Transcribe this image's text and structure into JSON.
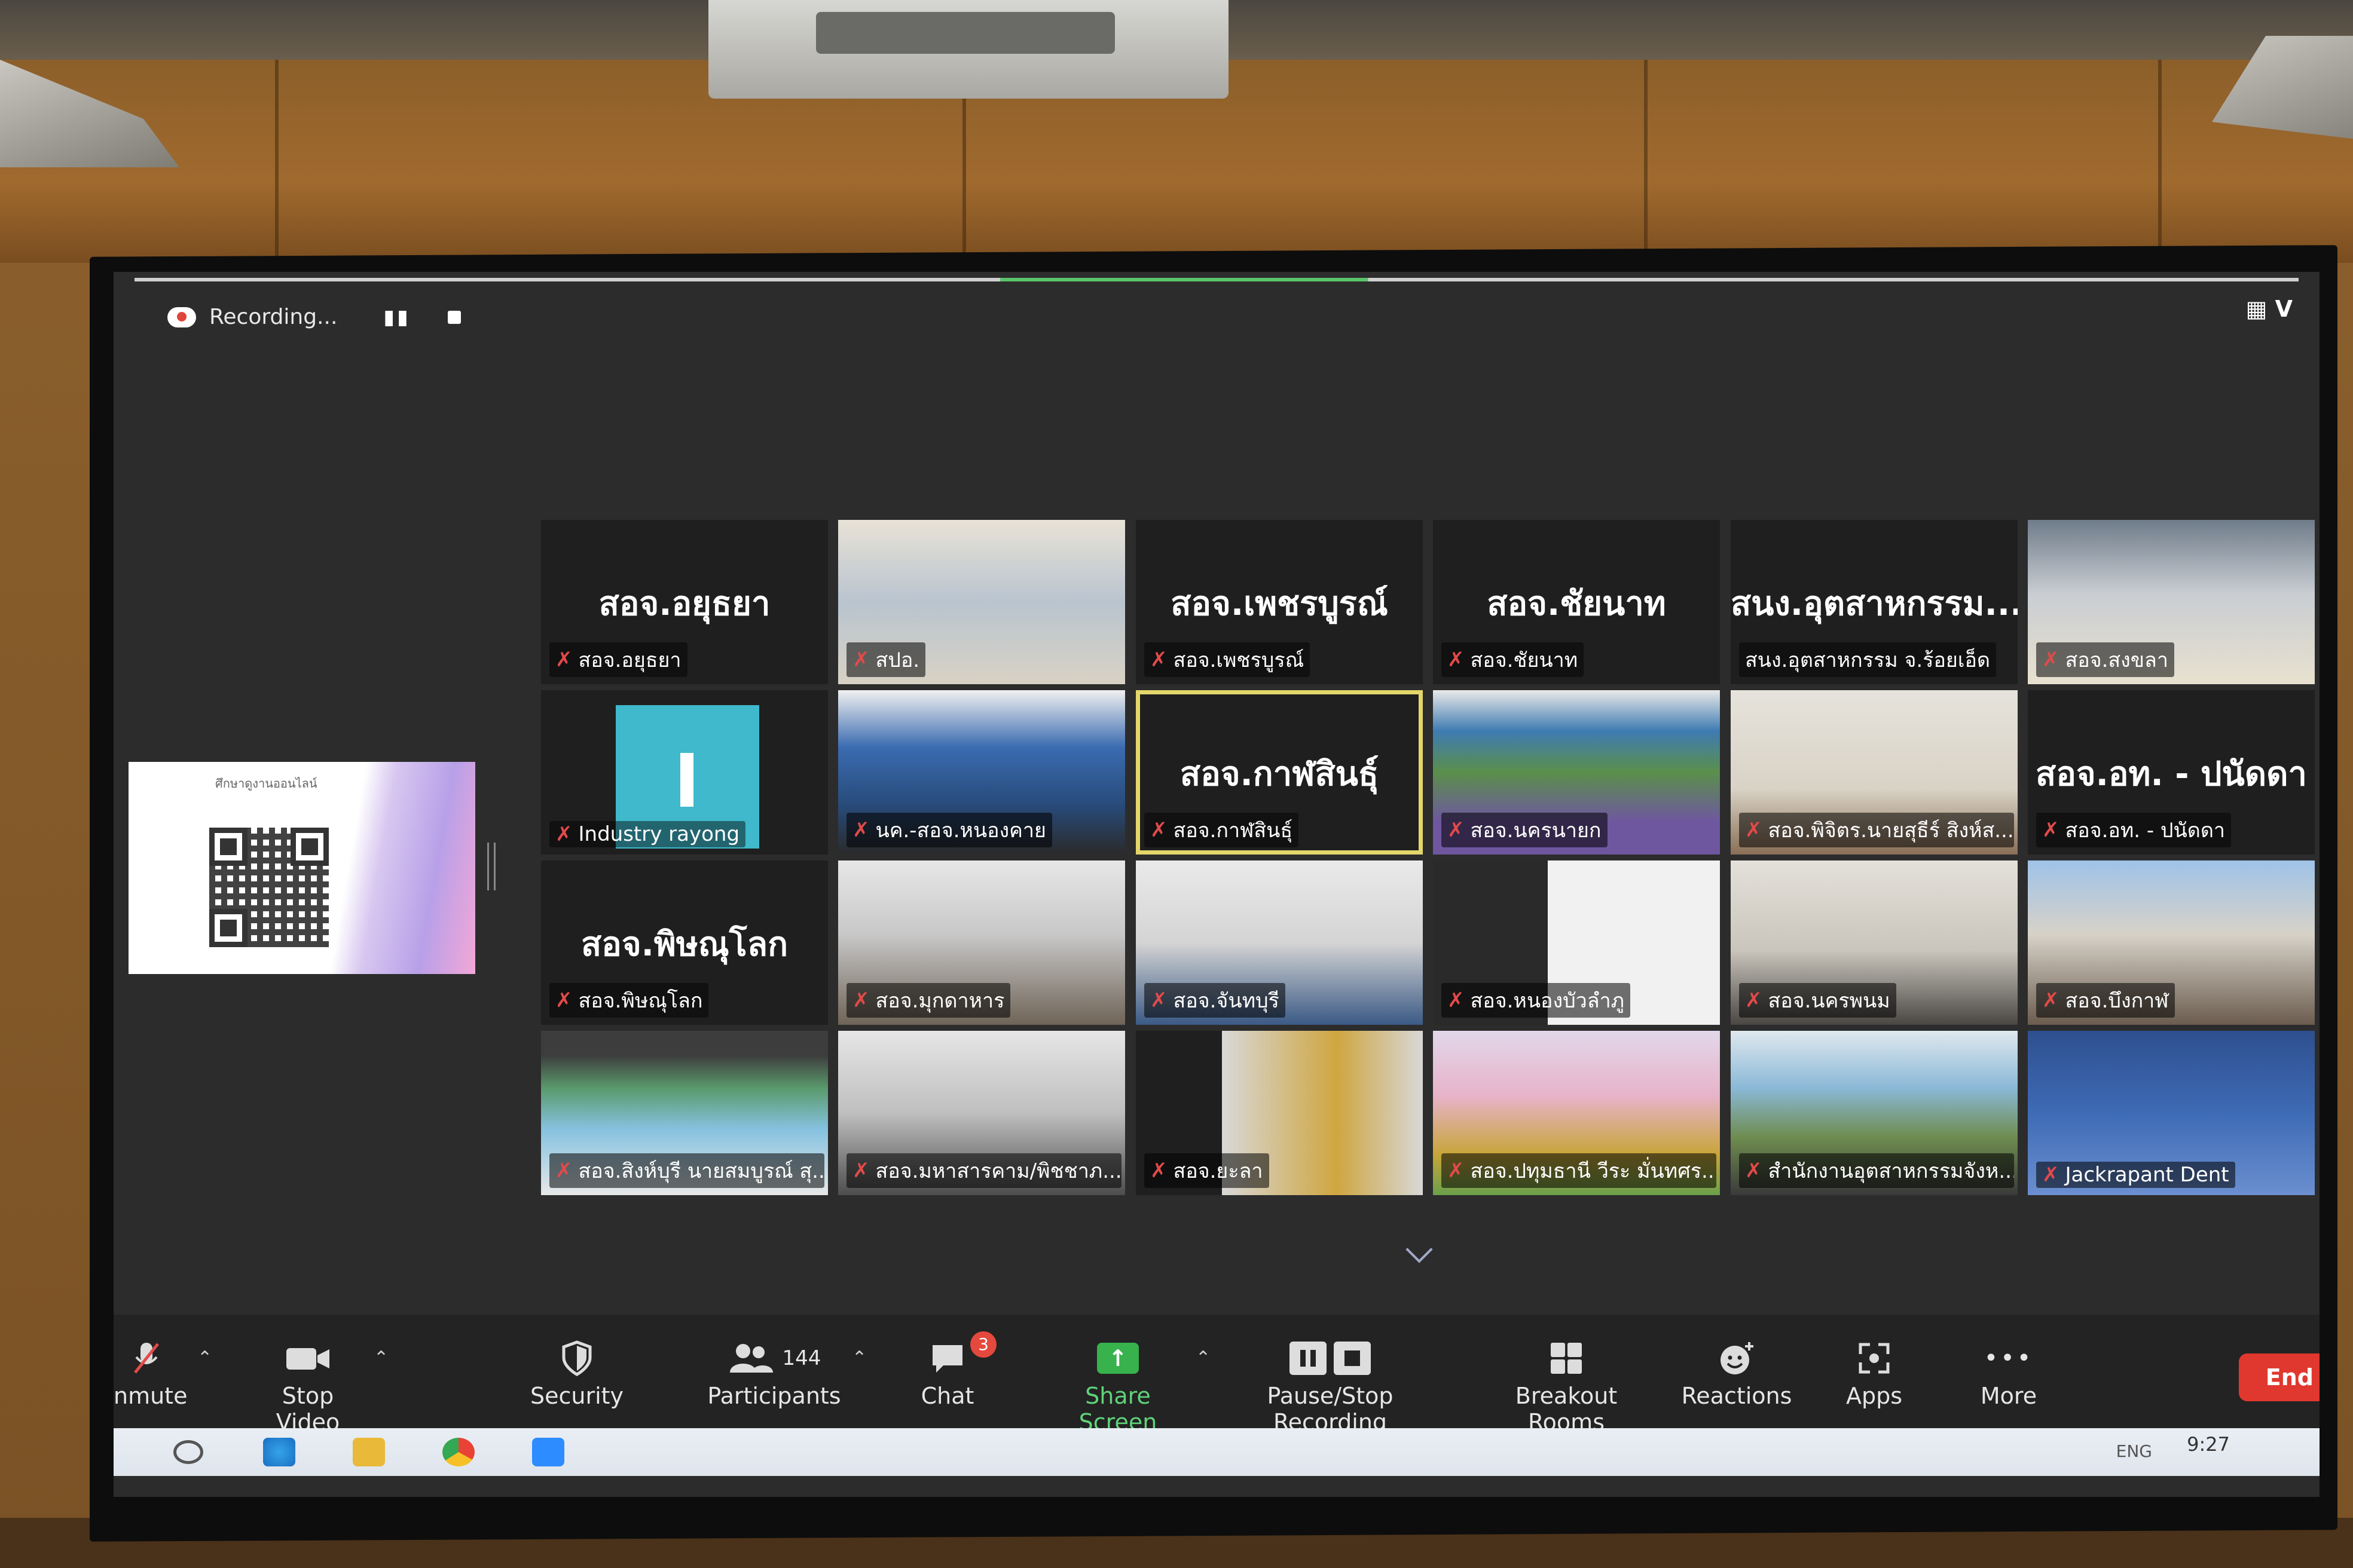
{
  "recording": {
    "label": "Recording...",
    "pause": "▮▮"
  },
  "view": {
    "label": "▦ V"
  },
  "share": {
    "caption": "ศึกษาดูงานออนไลน์"
  },
  "tiles": [
    {
      "big": "สอจ.อยุธยา",
      "name": "สอจ.อยุธยา",
      "muted": true
    },
    {
      "big": "",
      "name": "สปอ.",
      "muted": true
    },
    {
      "big": "สอจ.เพชรบูรณ์",
      "name": "สอจ.เพชรบูรณ์",
      "muted": true
    },
    {
      "big": "สอจ.ชัยนาท",
      "name": "สอจ.ชัยนาท",
      "muted": true
    },
    {
      "big": "สนง.อุตสาหกรรม...",
      "name": "สนง.อุตสาหกรรม จ.ร้อยเอ็ด",
      "muted": false
    },
    {
      "big": "",
      "name": "สอจ.สงขลา",
      "muted": true
    },
    {
      "big": "",
      "name": "Industry rayong",
      "muted": true
    },
    {
      "big": "",
      "name": "นค.-สอจ.หนองคาย",
      "muted": true
    },
    {
      "big": "สอจ.กาฬสินธุ์",
      "name": "สอจ.กาฬสินธุ์",
      "muted": true
    },
    {
      "big": "",
      "name": "สอจ.นครนายก",
      "muted": true
    },
    {
      "big": "",
      "name": "สอจ.พิจิตร.นายสุธีร์ สิงห์ส...",
      "muted": true
    },
    {
      "big": "สอจ.อท. - ปนัดดา",
      "name": "สอจ.อท. - ปนัดดา",
      "muted": true
    },
    {
      "big": "สอจ.พิษณุโลก",
      "name": "สอจ.พิษณุโลก",
      "muted": true
    },
    {
      "big": "",
      "name": "สอจ.มุกดาหาร",
      "muted": true
    },
    {
      "big": "",
      "name": "สอจ.จันทบุรี",
      "muted": true
    },
    {
      "big": "",
      "name": "สอจ.หนองบัวลำภู",
      "muted": true
    },
    {
      "big": "",
      "name": "สอจ.นครพนม",
      "muted": true
    },
    {
      "big": "",
      "name": "สอจ.บึงกาฬ",
      "muted": true
    },
    {
      "big": "",
      "name": "สอจ.สิงห์บุรี นายสมบูรณ์ สุ...",
      "muted": true
    },
    {
      "big": "",
      "name": "สอจ.มหาสารคาม/พิชชาภ...",
      "muted": true
    },
    {
      "big": "",
      "name": "สอจ.ยะลา",
      "muted": true
    },
    {
      "big": "",
      "name": "สอจ.ปทุมธานี วีระ มั่นทศร...",
      "muted": true
    },
    {
      "big": "",
      "name": "สำนักงานอุตสาหกรรมจังห...",
      "muted": true
    },
    {
      "big": "",
      "name": "Jackrapant Dent",
      "muted": true
    }
  ],
  "toolbar": {
    "unmute": "nmute",
    "stop_video": "Stop Video",
    "security": "Security",
    "participants": "Participants",
    "participants_count": "144",
    "chat": "Chat",
    "chat_badge": "3",
    "share_screen": "Share Screen",
    "recording": "Pause/Stop Recording",
    "breakout": "Breakout Rooms",
    "reactions": "Reactions",
    "apps": "Apps",
    "more": "More",
    "end": "End",
    "caret": "⌃",
    "mic_off": "✗",
    "more_glyph": "•••",
    "share_arrow": "↑"
  },
  "taskbar": {
    "time": "9:27",
    "lang": "ENG"
  },
  "colors": {
    "accent_green": "#5fd37a",
    "end_red": "#e0382e",
    "active_border": "#e4d76a"
  }
}
